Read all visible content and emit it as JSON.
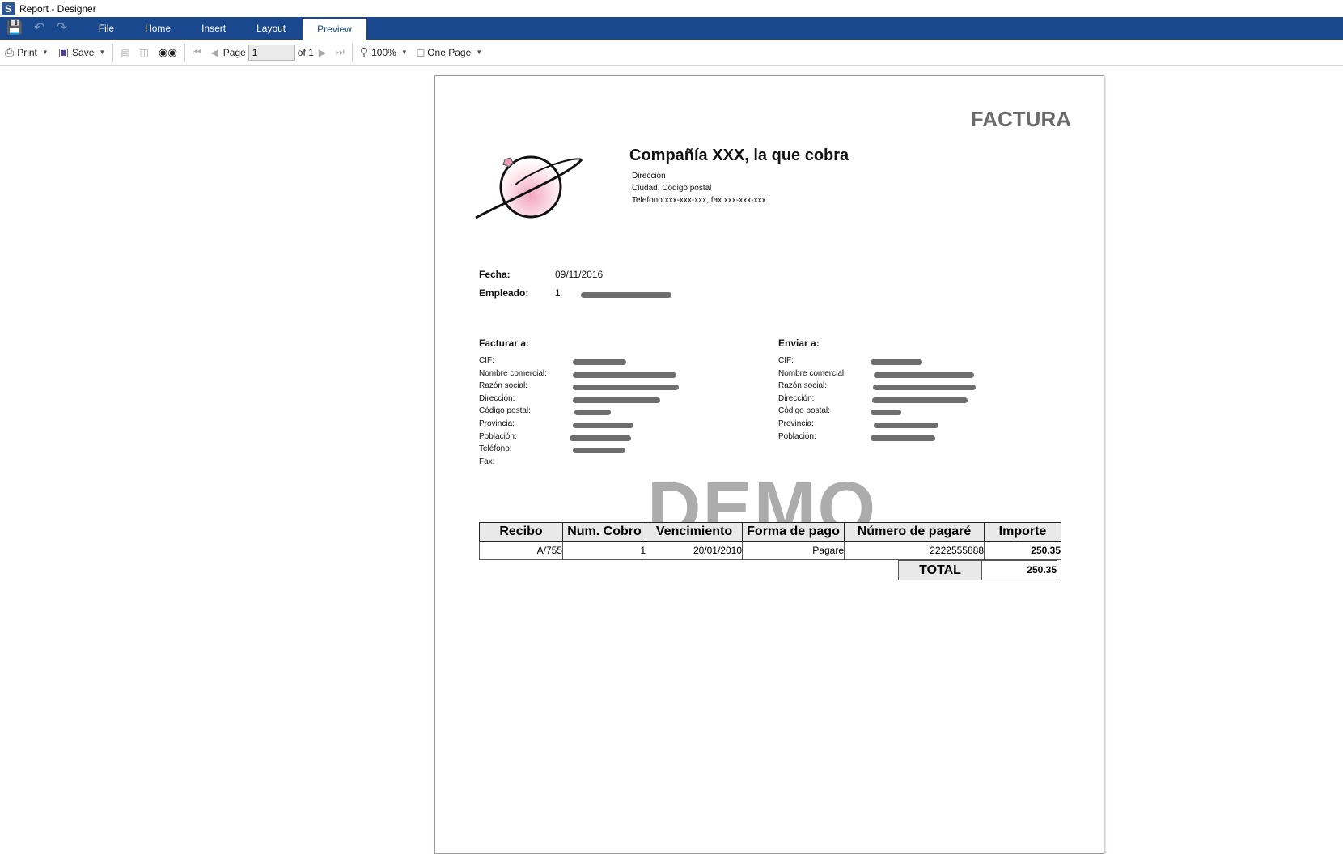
{
  "window": {
    "title": "Report - Designer"
  },
  "ribbon": {
    "tabs": [
      "File",
      "Home",
      "Insert",
      "Layout",
      "Preview"
    ],
    "active_tab": "Preview"
  },
  "toolbar": {
    "print_label": "Print",
    "save_label": "Save",
    "page_label": "Page",
    "page_value": "1",
    "page_of": "of 1",
    "zoom": "100%",
    "view_mode": "One Page"
  },
  "report": {
    "heading": "FACTURA",
    "company_name": "Compañía XXX, la que cobra",
    "address_line1": "Dirección",
    "address_line2": "Ciudad, Codigo postal",
    "phone_line": "Telefono xxx-xxx-xxx, fax xxx-xxx-xxx",
    "fecha_label": "Fecha:",
    "fecha_value": "09/11/2016",
    "empleado_label": "Empleado:",
    "empleado_value": "1",
    "bill_to": {
      "heading": "Facturar a:",
      "fields": [
        "CIF:",
        "Nombre comercial:",
        "Razón social:",
        "Dirección:",
        "Código postal:",
        "Provincia:",
        "Población:",
        "Teléfono:",
        "Fax:"
      ]
    },
    "ship_to": {
      "heading": "Enviar a:",
      "fields": [
        "CIF:",
        "Nombre comercial:",
        "Razón social:",
        "Dirección:",
        "Código postal:",
        "Provincia:",
        "Población:"
      ]
    },
    "watermark": "DEMO",
    "table": {
      "headers": [
        "Recibo",
        "Num. Cobro",
        "Vencimiento",
        "Forma de pago",
        "Número de pagaré",
        "Importe"
      ],
      "rows": [
        [
          "A/755",
          "1",
          "20/01/2010",
          "Pagare",
          "2222555888",
          "250.35"
        ]
      ],
      "total_label": "TOTAL",
      "total_value": "250.35"
    }
  }
}
